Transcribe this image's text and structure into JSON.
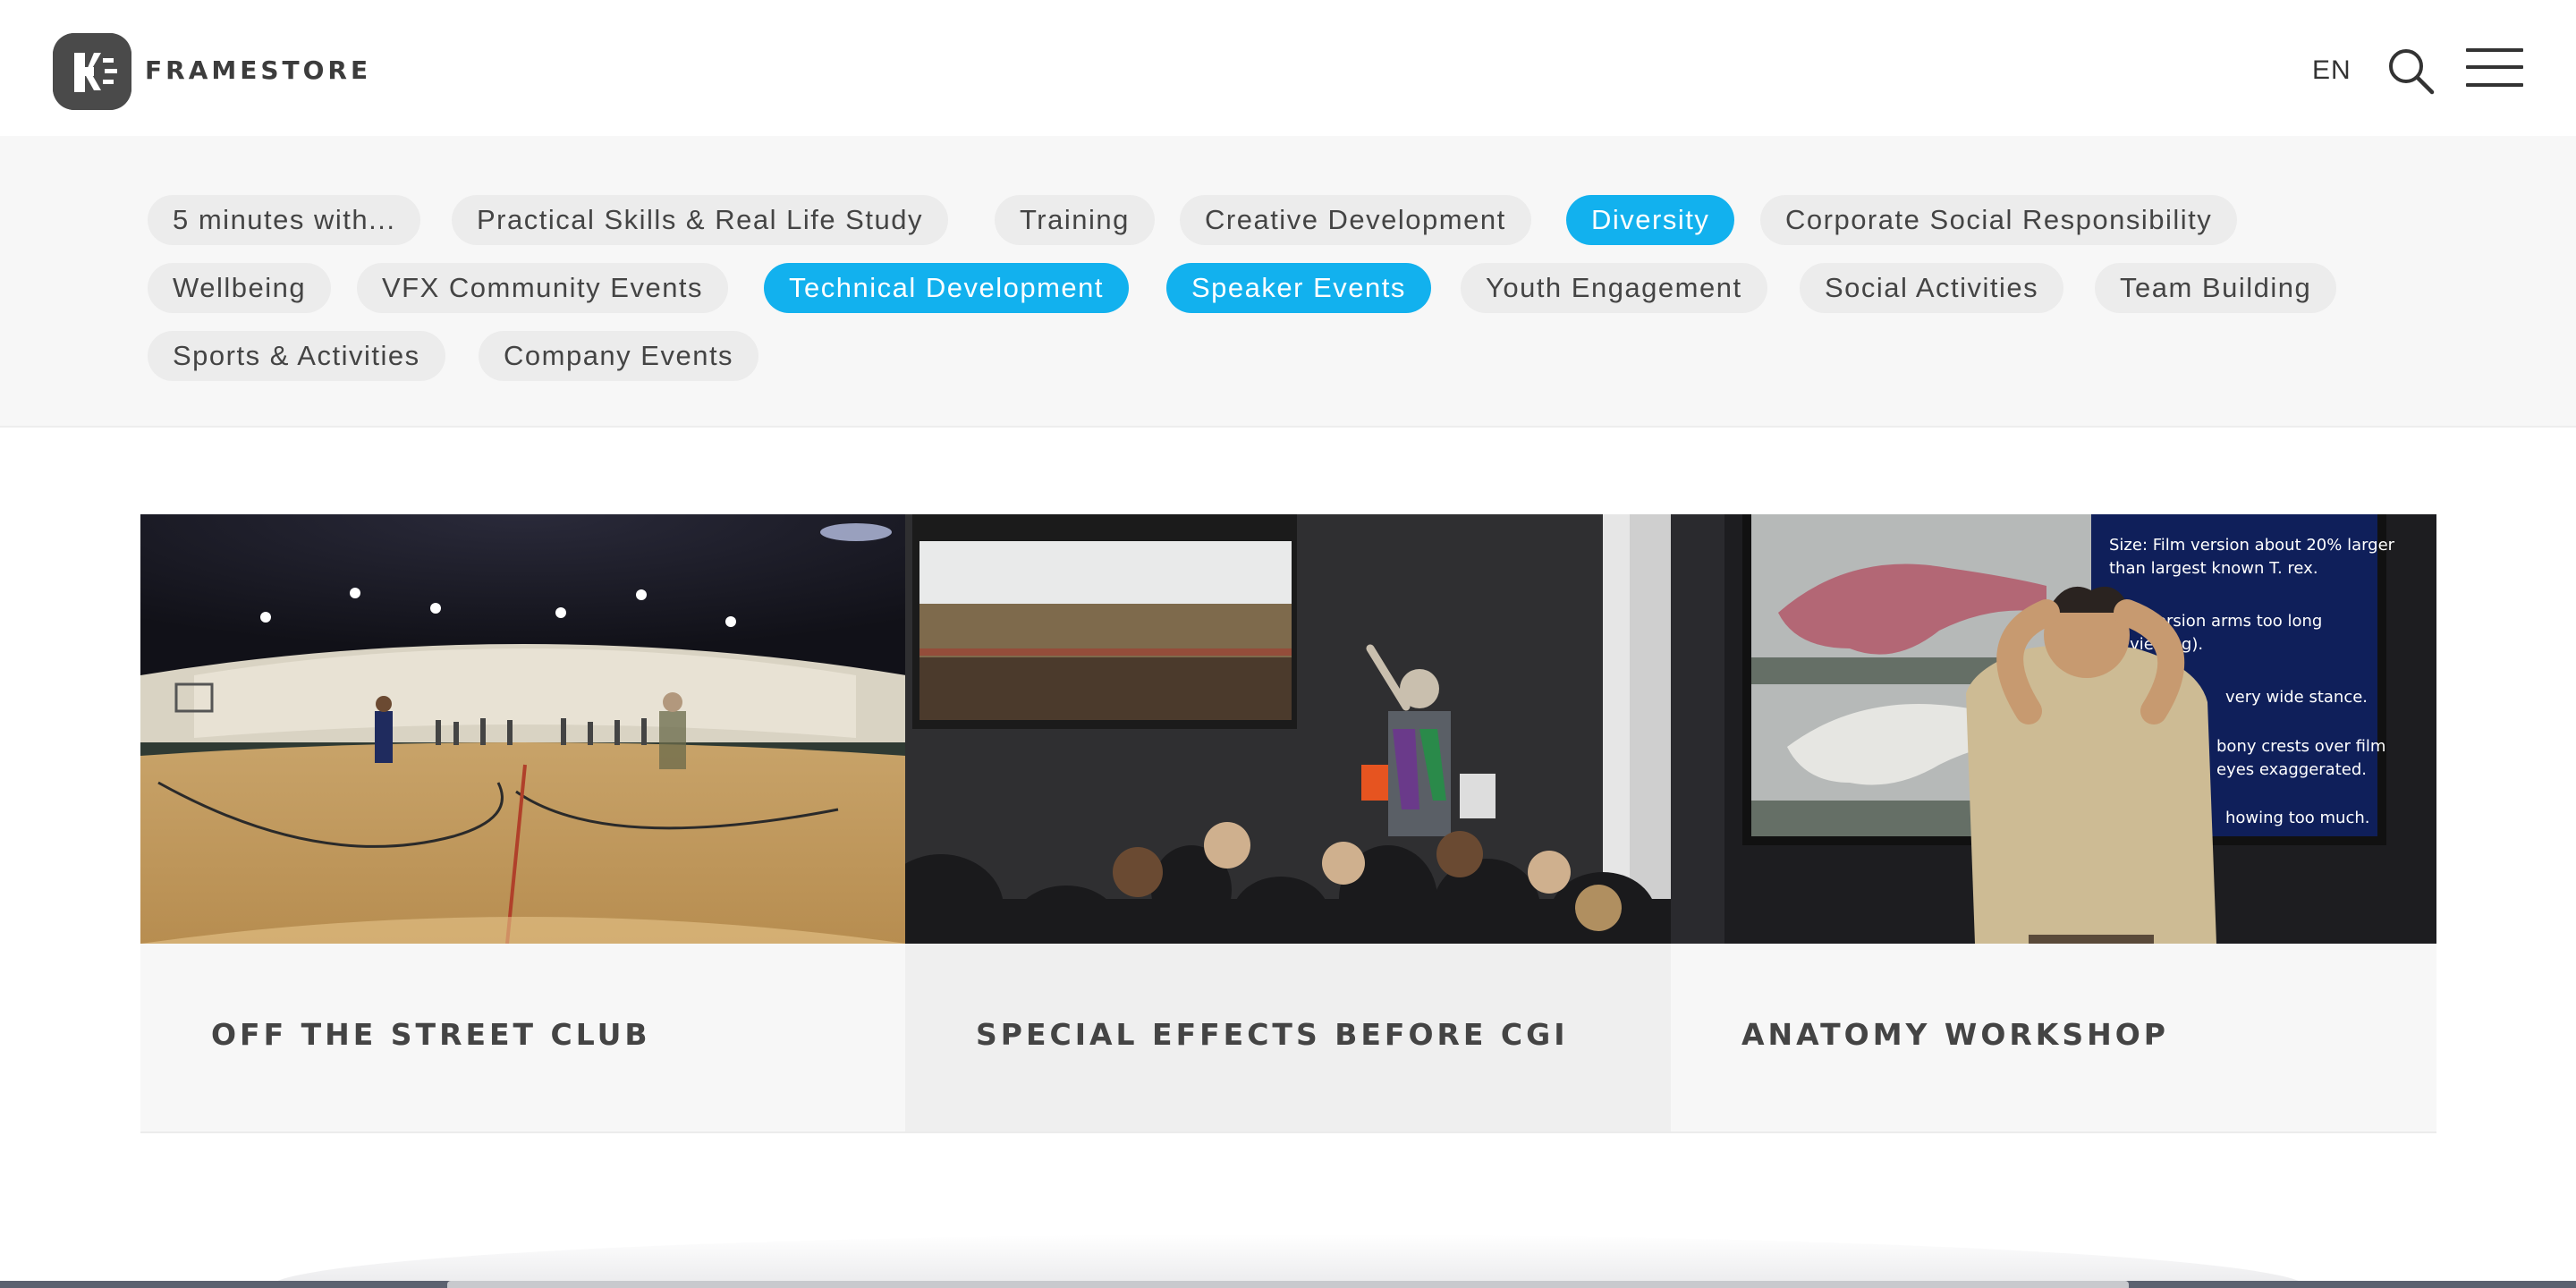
{
  "brand": {
    "name": "FRAMESTORE"
  },
  "header": {
    "language": "EN",
    "search_icon": "search-icon",
    "menu_icon": "hamburger-menu-icon"
  },
  "filters": [
    {
      "label": "5 minutes with...",
      "active": false
    },
    {
      "label": "Practical Skills & Real Life Study",
      "active": false
    },
    {
      "label": "Training",
      "active": false
    },
    {
      "label": "Creative Development",
      "active": false
    },
    {
      "label": "Diversity",
      "active": true
    },
    {
      "label": "Corporate Social Responsibility",
      "active": false
    },
    {
      "label": "Wellbeing",
      "active": false
    },
    {
      "label": "VFX Community Events",
      "active": false
    },
    {
      "label": "Technical Development",
      "active": true
    },
    {
      "label": "Speaker Events",
      "active": true
    },
    {
      "label": "Youth Engagement",
      "active": false
    },
    {
      "label": "Social Activities",
      "active": false
    },
    {
      "label": "Team Building",
      "active": false
    },
    {
      "label": "Sports & Activities",
      "active": false
    },
    {
      "label": "Company Events",
      "active": false
    }
  ],
  "cards": [
    {
      "title": "OFF THE STREET CLUB"
    },
    {
      "title": "SPECIAL EFFECTS BEFORE CGI"
    },
    {
      "title": "ANATOMY WORKSHOP"
    }
  ],
  "colors": {
    "accent": "#12b1ee",
    "pill": "#ececec",
    "text": "#444444"
  }
}
